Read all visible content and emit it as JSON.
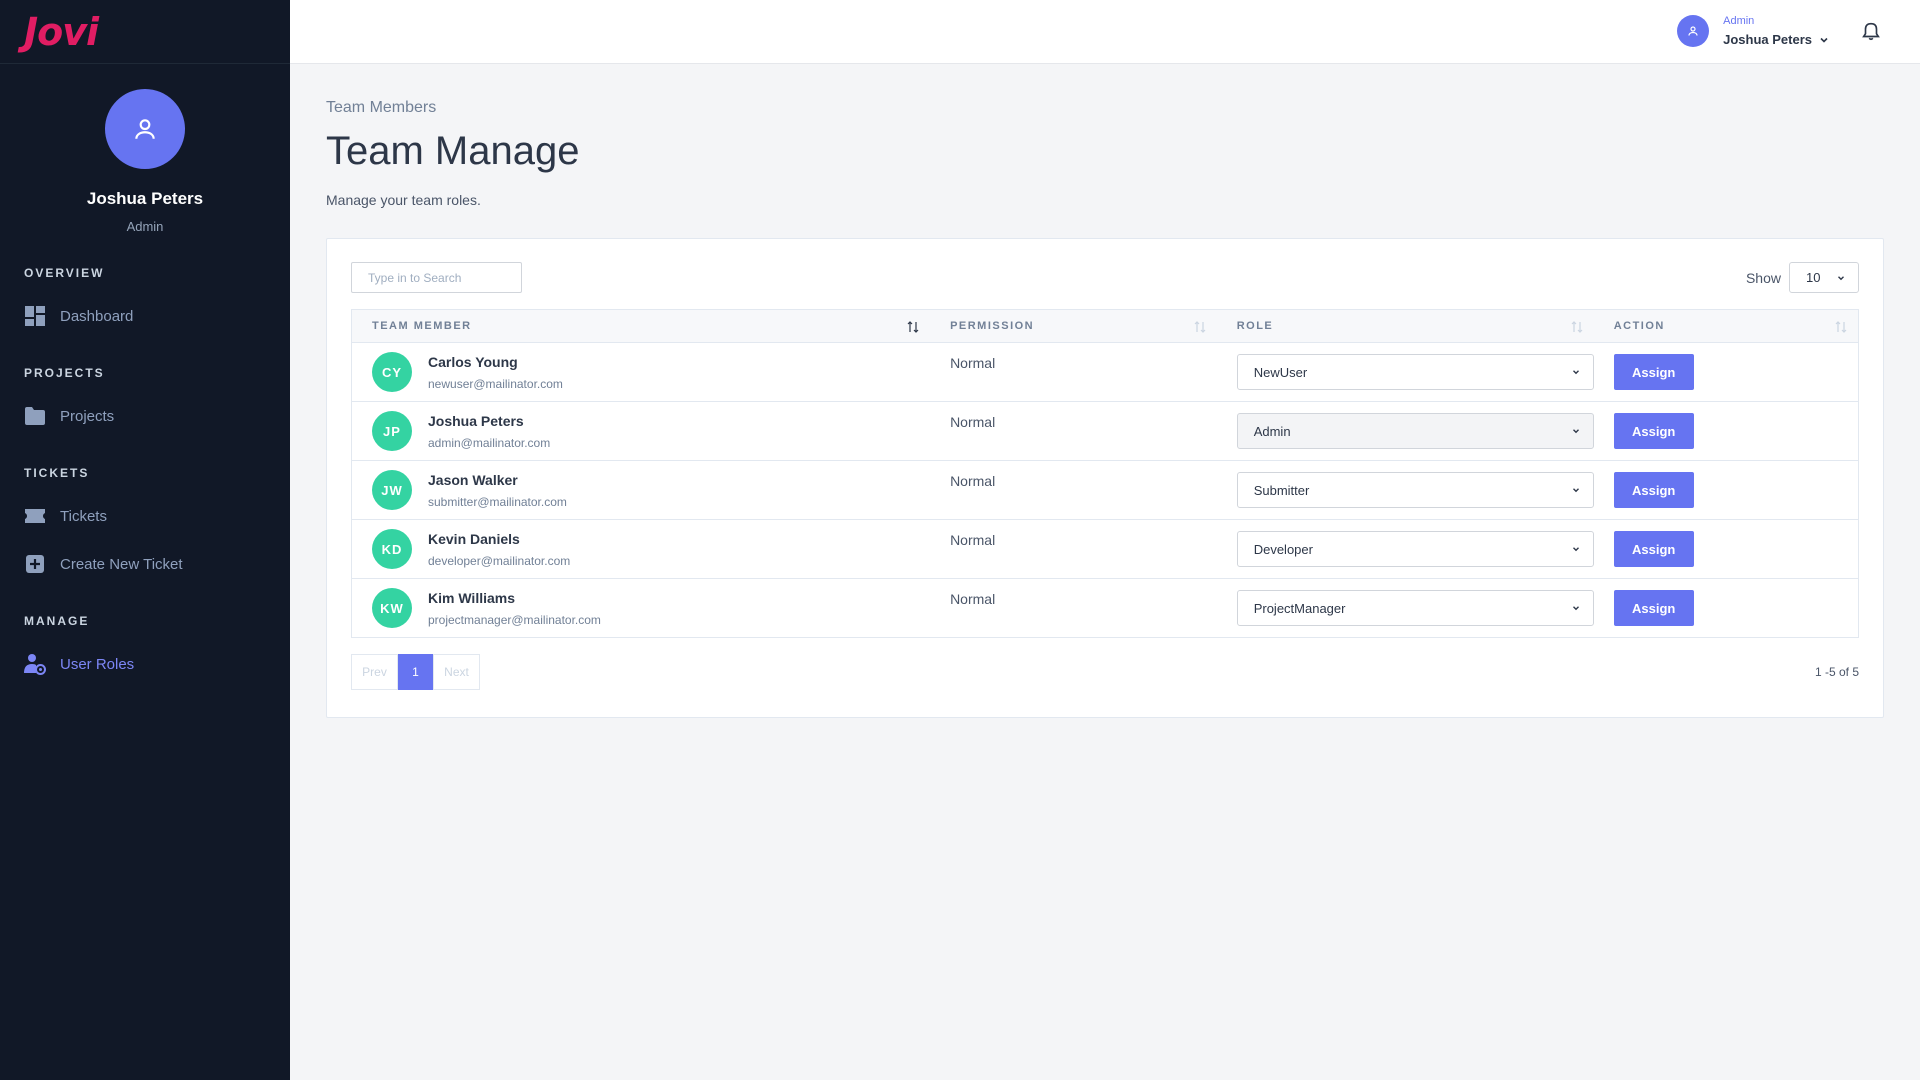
{
  "brand": {
    "name": "Jovi"
  },
  "sidebar": {
    "profile": {
      "name": "Joshua Peters",
      "role": "Admin"
    },
    "sections": [
      {
        "heading": "OVERVIEW",
        "items": [
          {
            "label": "Dashboard",
            "icon": "dashboard-icon"
          }
        ]
      },
      {
        "heading": "PROJECTS",
        "items": [
          {
            "label": "Projects",
            "icon": "folder-icon"
          }
        ]
      },
      {
        "heading": "TICKETS",
        "items": [
          {
            "label": "Tickets",
            "icon": "ticket-icon"
          },
          {
            "label": "Create New Ticket",
            "icon": "plus-square-icon"
          }
        ]
      },
      {
        "heading": "MANAGE",
        "items": [
          {
            "label": "User Roles",
            "icon": "user-settings-icon",
            "active": true
          }
        ]
      }
    ]
  },
  "header": {
    "user": {
      "role": "Admin",
      "name": "Joshua Peters"
    }
  },
  "main": {
    "breadcrumb": "Team Members",
    "title": "Team Manage",
    "description": "Manage your team roles."
  },
  "table": {
    "search_placeholder": "Type in to Search",
    "show_label": "Show",
    "page_size": "10",
    "columns": [
      "TEAM MEMBER",
      "PERMISSION",
      "ROLE",
      "ACTION"
    ],
    "rows": [
      {
        "initials": "CY",
        "name": "Carlos Young",
        "email": "newuser@mailinator.com",
        "permission": "Normal",
        "role": "NewUser",
        "action": "Assign",
        "disabled": false
      },
      {
        "initials": "JP",
        "name": "Joshua Peters",
        "email": "admin@mailinator.com",
        "permission": "Normal",
        "role": "Admin",
        "action": "Assign",
        "disabled": true
      },
      {
        "initials": "JW",
        "name": "Jason Walker",
        "email": "submitter@mailinator.com",
        "permission": "Normal",
        "role": "Submitter",
        "action": "Assign",
        "disabled": false
      },
      {
        "initials": "KD",
        "name": "Kevin Daniels",
        "email": "developer@mailinator.com",
        "permission": "Normal",
        "role": "Developer",
        "action": "Assign",
        "disabled": false
      },
      {
        "initials": "KW",
        "name": "Kim Williams",
        "email": "projectmanager@mailinator.com",
        "permission": "Normal",
        "role": "ProjectManager",
        "action": "Assign",
        "disabled": false
      }
    ],
    "pagination": {
      "prev": "Prev",
      "current": "1",
      "next": "Next",
      "range": "1 -5 of 5"
    }
  },
  "colors": {
    "accent": "#6674f1",
    "brand": "#e11d63",
    "avatar": "#34d3a2",
    "sidebar_bg": "#111827"
  }
}
